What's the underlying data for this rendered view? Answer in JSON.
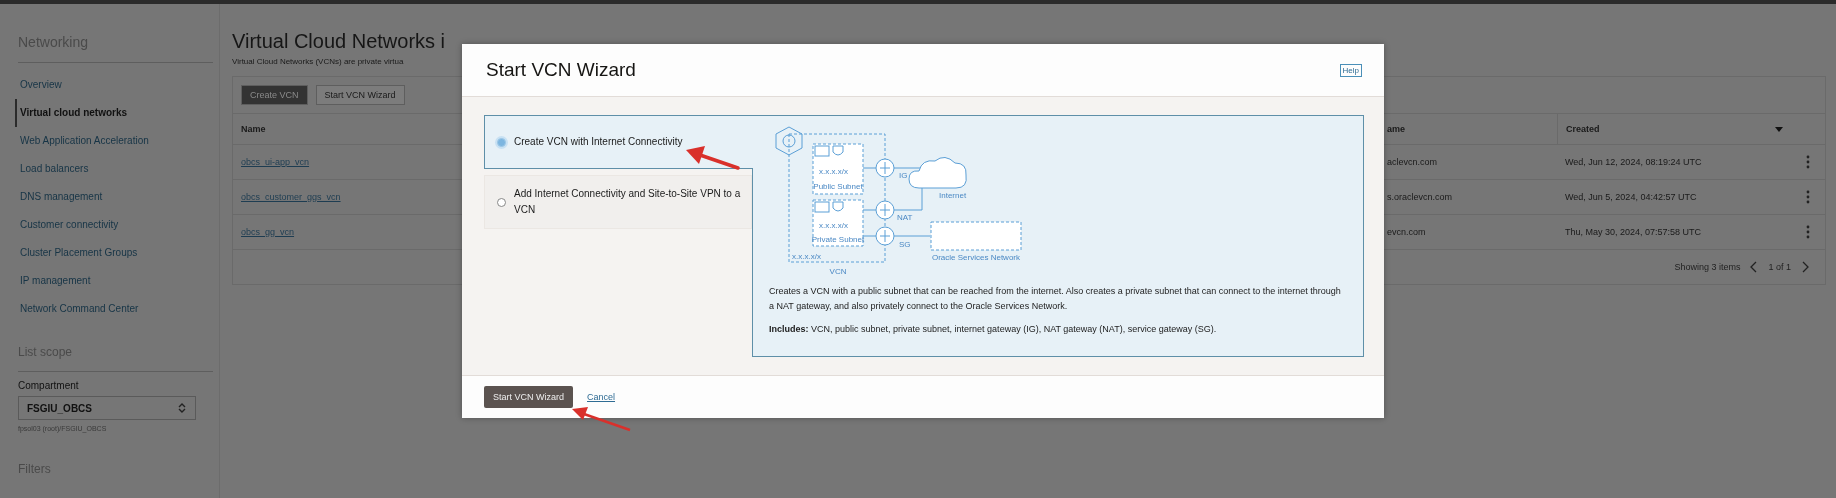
{
  "sidebar": {
    "title": "Networking",
    "items": [
      {
        "label": "Overview",
        "selected": false
      },
      {
        "label": "Virtual cloud networks",
        "selected": true
      },
      {
        "label": "Web Application Acceleration",
        "selected": false
      },
      {
        "label": "Load balancers",
        "selected": false
      },
      {
        "label": "DNS management",
        "selected": false
      },
      {
        "label": "Customer connectivity",
        "selected": false
      },
      {
        "label": "Cluster Placement Groups",
        "selected": false
      },
      {
        "label": "IP management",
        "selected": false
      },
      {
        "label": "Network Command Center",
        "selected": false
      }
    ],
    "list_scope": "List scope",
    "compartment_label": "Compartment",
    "compartment_value": "FSGIU_OBCS",
    "compartment_path": "fpsol03 (root)/FSGIU_OBCS",
    "filters": "Filters"
  },
  "page": {
    "title": "Virtual Cloud Networks i",
    "description": "Virtual Cloud Networks (VCNs) are private virtua",
    "buttons": [
      {
        "label": "Create VCN",
        "primary": true
      },
      {
        "label": "Start VCN Wizard",
        "primary": false
      }
    ]
  },
  "table": {
    "columns": [
      {
        "label": "Name"
      },
      {
        "label": "ame"
      },
      {
        "label": "Created",
        "sorted": true
      }
    ],
    "rows": [
      {
        "cells": [
          "obcs_ui-app_vcn",
          "aclevcn.com",
          "Wed, Jun 12, 2024, 08:19:24 UTC"
        ]
      },
      {
        "cells": [
          "obcs_customer_ggs_vcn",
          "s.oraclevcn.com",
          "Wed, Jun 5, 2024, 04:42:57 UTC"
        ]
      },
      {
        "cells": [
          "obcs_gg_vcn",
          "evcn.com",
          "Thu, May 30, 2024, 07:57:58 UTC"
        ]
      }
    ],
    "footer": "Showing 3 items",
    "pager": "1 of 1"
  },
  "dialog": {
    "title": "Start VCN Wizard",
    "help": "Help",
    "options": [
      {
        "label": "Create VCN with Internet Connectivity",
        "selected": true
      },
      {
        "label": "Add Internet Connectivity and Site-to-Site VPN to a VCN",
        "selected": false
      }
    ],
    "diagram_labels": {
      "vcn": "VCN",
      "public_subnet": "Public Subnet",
      "private_subnet": "Private Subnet",
      "cidr_public": "x.x.x.x/x",
      "cidr_private": "x.x.x.x/x",
      "cidr_vcn": "x.x.x.x/x",
      "ig": "IG",
      "nat": "NAT",
      "sg": "SG",
      "internet": "Internet",
      "services": "Oracle Services Network"
    },
    "description": "Creates a VCN with a public subnet that can be reached from the internet. Also creates a private subnet that can connect to the internet through a NAT gateway, and also privately connect to the Oracle Services Network.",
    "includes": "**Includes:** VCN, public subnet, private subnet, internet gateway (IG), NAT gateway (NAT), service gateway (SG).",
    "primary_button": "Start VCN Wizard",
    "cancel": "Cancel"
  }
}
